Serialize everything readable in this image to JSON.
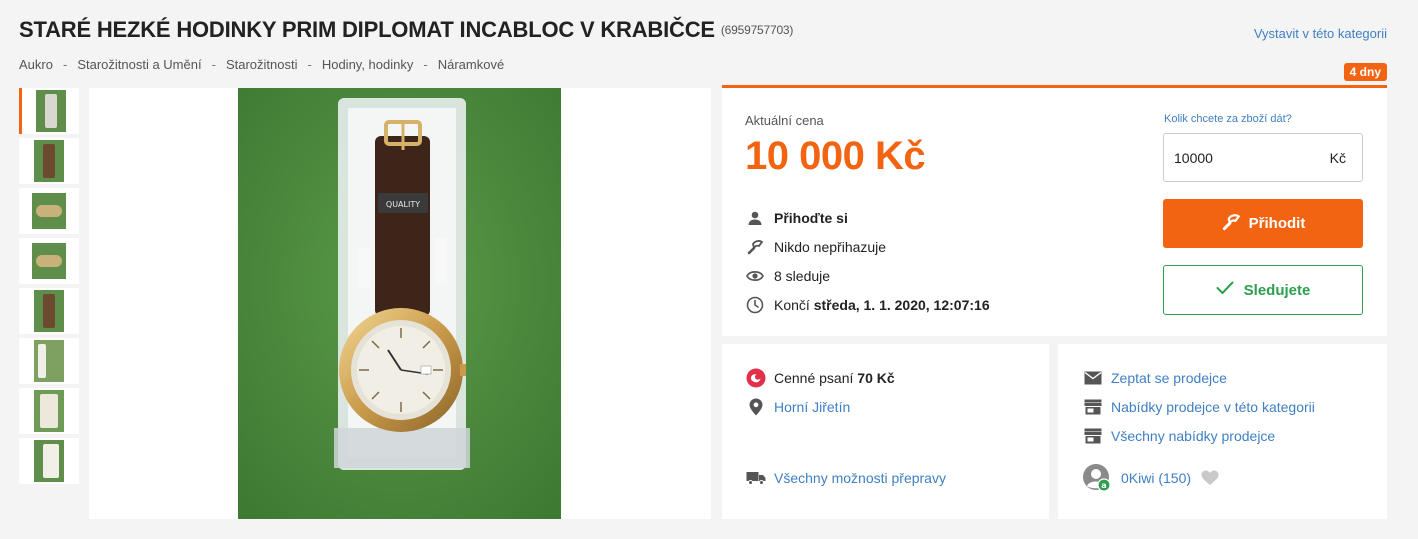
{
  "header": {
    "title": "STARÉ HEZKÉ HODINKY PRIM DIPLOMAT INCABLOC V KRABIČCE",
    "item_id": "(6959757703)",
    "list_in_category": "Vystavit v této kategorii",
    "time_left": "4 dny"
  },
  "breadcrumb": [
    "Aukro",
    "Starožitnosti a Umění",
    "Starožitnosti",
    "Hodiny, hodinky",
    "Náramkové"
  ],
  "gallery": {
    "thumbnail_count": 8,
    "active_index": 0
  },
  "price_panel": {
    "price_label": "Aktuální cena",
    "price_value": "10 000 Kč",
    "bid_info": "Přihoďte si",
    "bidders": "Nikdo nepřihazuje",
    "watchers": "8 sleduje",
    "ends_prefix": "Končí",
    "ends_value": "středa, 1. 1. 2020, 12:07:16",
    "bid_question": "Kolik chcete za zboží dát?",
    "bid_input_value": "10000",
    "bid_currency": "Kč",
    "bid_button": "Přihodit",
    "watch_button": "Sledujete"
  },
  "shipping": {
    "method_prefix": "Cenné psaní",
    "method_price": "70 Kč",
    "location": "Horní Jiřetín",
    "all_shipping": "Všechny možnosti přepravy"
  },
  "seller": {
    "ask_seller": "Zeptat se prodejce",
    "offers_in_category": "Nabídky prodejce v této kategorii",
    "all_offers": "Všechny nabídky prodejce",
    "name": "0Kiwi",
    "rating": "(150)"
  },
  "colors": {
    "accent": "#f26411",
    "link": "#3f7fc4",
    "success": "#2e9e4f"
  }
}
